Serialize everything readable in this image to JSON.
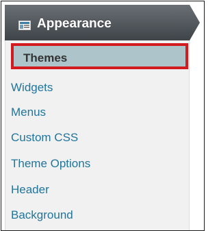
{
  "colors": {
    "header_bg": "#4a4f55",
    "header_text": "#ffffff",
    "submenu_bg": "#f1f1f1",
    "link": "#21759b",
    "current_bg": "#adc4cb",
    "current_text": "#333333",
    "highlight_border": "#d21a1f"
  },
  "header": {
    "icon": "appearance-icon",
    "label": "Appearance"
  },
  "submenu": {
    "items": [
      {
        "label": "Themes",
        "current": true
      },
      {
        "label": "Widgets"
      },
      {
        "label": "Menus"
      },
      {
        "label": "Custom CSS"
      },
      {
        "label": "Theme Options"
      },
      {
        "label": "Header"
      },
      {
        "label": "Background"
      }
    ]
  }
}
